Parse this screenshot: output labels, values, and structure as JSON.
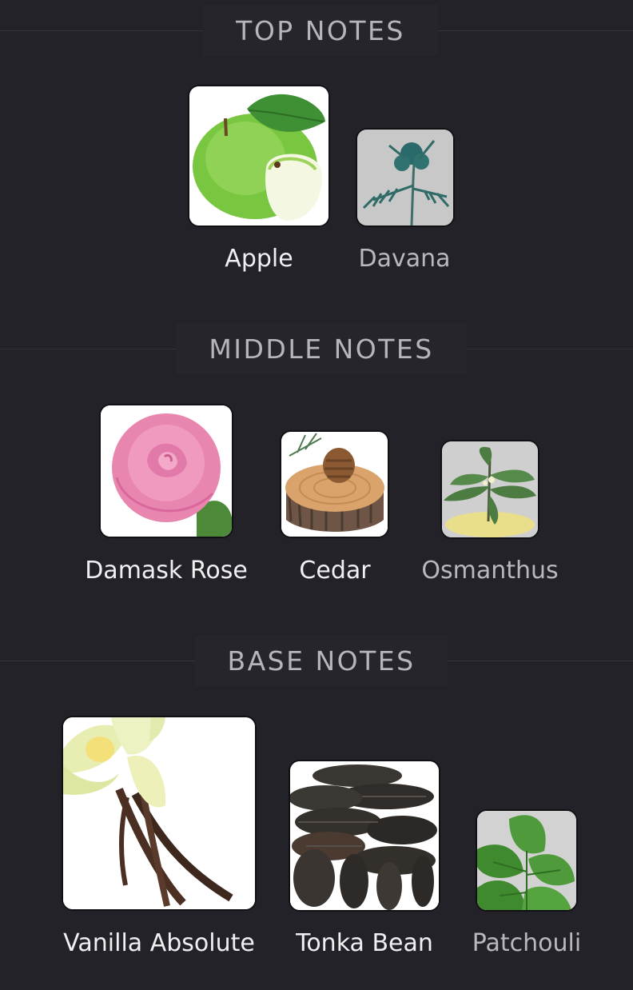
{
  "sections": {
    "top": {
      "title": "TOP NOTES",
      "notes": [
        {
          "label": "Apple",
          "icon": "apple-image"
        },
        {
          "label": "Davana",
          "icon": "davana-image"
        }
      ]
    },
    "middle": {
      "title": "MIDDLE NOTES",
      "notes": [
        {
          "label": "Damask Rose",
          "icon": "rose-image"
        },
        {
          "label": "Cedar",
          "icon": "cedar-image"
        },
        {
          "label": "Osmanthus",
          "icon": "osmanthus-image"
        }
      ]
    },
    "base": {
      "title": "BASE NOTES",
      "notes": [
        {
          "label": "Vanilla Absolute",
          "icon": "vanilla-image"
        },
        {
          "label": "Tonka Bean",
          "icon": "tonka-bean-image"
        },
        {
          "label": "Patchouli",
          "icon": "patchouli-image"
        }
      ]
    }
  },
  "colors": {
    "background": "#232228",
    "header_text": "#b6b5bb",
    "label_primary": "#f0f0f2",
    "label_secondary": "#b9b8bf"
  }
}
